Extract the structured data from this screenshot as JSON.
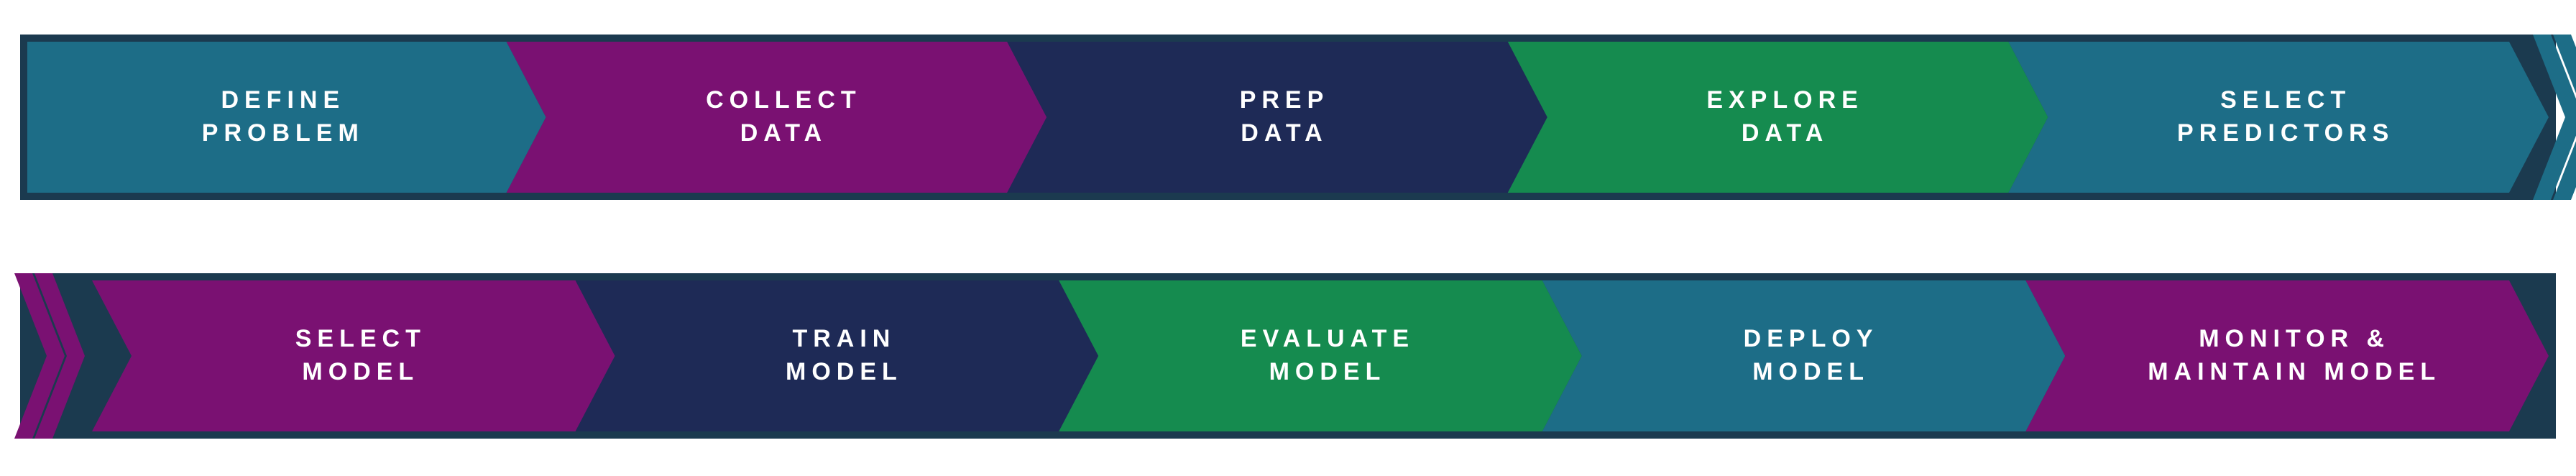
{
  "colors": {
    "outline": "#1b3a4f",
    "teal": "#1d6d87",
    "magenta": "#7a1172",
    "navy": "#1e2a56",
    "green": "#158b4f",
    "text": "#ffffff"
  },
  "row1": {
    "steps": [
      {
        "label": "DEFINE PROBLEM",
        "line1": "DEFINE",
        "line2": "PROBLEM",
        "color": "teal"
      },
      {
        "label": "COLLECT DATA",
        "line1": "COLLECT",
        "line2": "DATA",
        "color": "magenta"
      },
      {
        "label": "PREP DATA",
        "line1": "PREP",
        "line2": "DATA",
        "color": "navy"
      },
      {
        "label": "EXPLORE DATA",
        "line1": "EXPLORE",
        "line2": "DATA",
        "color": "green"
      },
      {
        "label": "SELECT PREDICTORS",
        "line1": "SELECT",
        "line2": "PREDICTORS",
        "color": "teal"
      }
    ]
  },
  "row2": {
    "steps": [
      {
        "label": "SELECT MODEL",
        "line1": "SELECT",
        "line2": "MODEL",
        "color": "magenta"
      },
      {
        "label": "TRAIN MODEL",
        "line1": "TRAIN",
        "line2": "MODEL",
        "color": "navy"
      },
      {
        "label": "EVALUATE MODEL",
        "line1": "EVALUATE",
        "line2": "MODEL",
        "color": "green"
      },
      {
        "label": "DEPLOY MODEL",
        "line1": "DEPLOY",
        "line2": "MODEL",
        "color": "teal"
      },
      {
        "label": "MONITOR & MAINTAIN MODEL",
        "line1": "MONITOR &",
        "line2": "MAINTAIN MODEL",
        "color": "magenta"
      }
    ]
  }
}
